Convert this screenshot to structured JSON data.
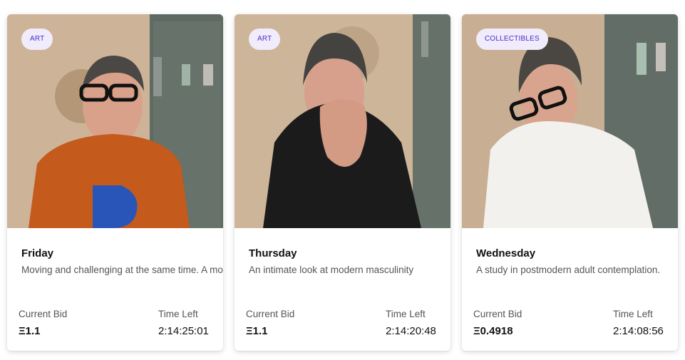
{
  "cards": [
    {
      "category": "ART",
      "title": "Friday",
      "description": "Moving and challenging at the same time. A more thoughtful reflection on the week.",
      "bid_label": "Current Bid",
      "bid_value": "Ξ1.1",
      "time_label": "Time Left",
      "time_value": "2:14:25:01",
      "shirt_color": "#c45a1c"
    },
    {
      "category": "ART",
      "title": "Thursday",
      "description": "An intimate look at modern masculinity",
      "bid_label": "Current Bid",
      "bid_value": "Ξ1.1",
      "time_label": "Time Left",
      "time_value": "2:14:20:48",
      "shirt_color": "#1b1b1b"
    },
    {
      "category": "COLLECTIBLES",
      "title": "Wednesday",
      "description": "A study in postmodern adult contemplation.",
      "bid_label": "Current Bid",
      "bid_value": "Ξ0.4918",
      "time_label": "Time Left",
      "time_value": "2:14:08:56",
      "shirt_color": "#f3f1ee"
    }
  ]
}
